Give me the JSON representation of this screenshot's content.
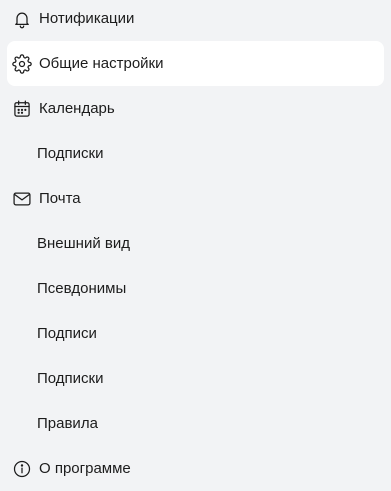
{
  "sidebar": {
    "items": [
      {
        "label": "Нотификации",
        "icon": "bell-icon"
      },
      {
        "label": "Общие настройки",
        "icon": "gear-icon",
        "selected": true
      },
      {
        "label": "Календарь",
        "icon": "calendar-icon"
      },
      {
        "label": "Подписки"
      },
      {
        "label": "Почта",
        "icon": "mail-icon"
      },
      {
        "label": "Внешний вид"
      },
      {
        "label": "Псевдонимы"
      },
      {
        "label": "Подписи"
      },
      {
        "label": "Подписки"
      },
      {
        "label": "Правила"
      },
      {
        "label": "О программе",
        "icon": "info-icon"
      }
    ]
  },
  "colors": {
    "background": "#f2f3f5",
    "selected_background": "#ffffff",
    "text": "#1c1c1c"
  }
}
